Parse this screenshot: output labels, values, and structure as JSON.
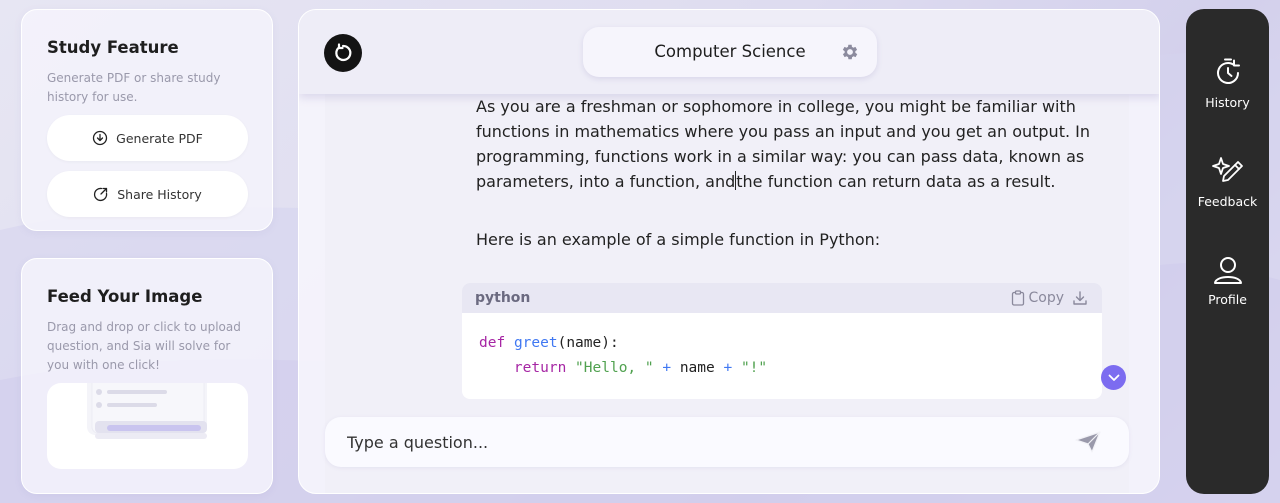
{
  "study_feature": {
    "title": "Study Feature",
    "description": "Generate PDF or share study history for use.",
    "generate_pdf_label": "Generate PDF",
    "share_history_label": "Share History"
  },
  "feed_image": {
    "title": "Feed Your Image",
    "description": "Drag and drop or click to upload question, and Sia will solve for you with one click!"
  },
  "header": {
    "subject": "Computer Science"
  },
  "chat": {
    "paragraph_1_part_a": "As you are a freshman or sophomore in college, you might be familiar with functions in mathematics where you pass an input and you get an output. In programming, functions work in a similar way: you can pass data, known as parameters, into a function, and",
    "paragraph_1_part_b": "the function can return data as a result.",
    "paragraph_2": "Here is an example of a simple function in Python:",
    "code": {
      "language": "python",
      "copy_label": "Copy",
      "line1_kw": "def",
      "line1_fn": "greet",
      "line1_rest": "(name):",
      "line2_kw": "return",
      "line2_str1": "\"Hello, \"",
      "line2_op1": "+",
      "line2_var": "name",
      "line2_op2": "+",
      "line2_str2": "\"!\""
    }
  },
  "input": {
    "placeholder": "Type a question..."
  },
  "sidebar": {
    "items": [
      {
        "label": "History",
        "icon": "history-icon"
      },
      {
        "label": "Feedback",
        "icon": "sparkle-pen-icon"
      },
      {
        "label": "Profile",
        "icon": "user-icon"
      }
    ]
  },
  "colors": {
    "accent": "#7c6cf0",
    "sidebar_bg": "#2a2a2a",
    "keyword": "#a626a4",
    "function": "#4078f2",
    "string": "#50a14f"
  }
}
